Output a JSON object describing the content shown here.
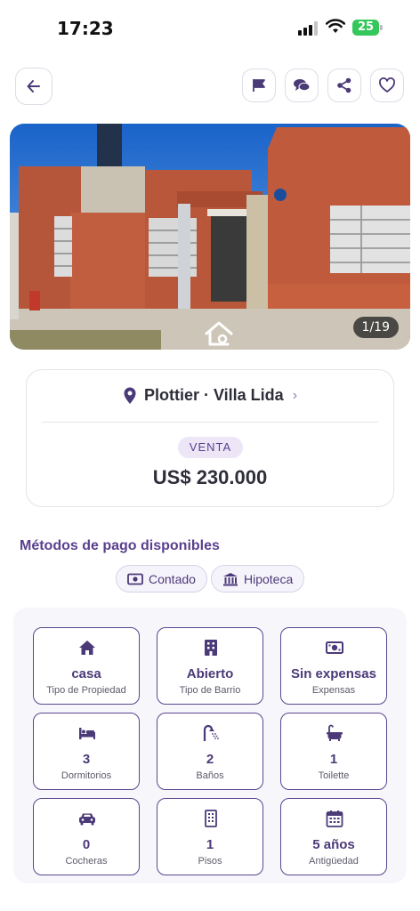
{
  "status_bar": {
    "time": "17:23",
    "battery": "25"
  },
  "header": {
    "back_icon": "arrow-left-icon",
    "actions": [
      "flag-icon",
      "chat-icon",
      "share-icon",
      "heart-icon"
    ]
  },
  "gallery": {
    "counter": "1/19"
  },
  "listing": {
    "location": "Plottier · Villa Lida",
    "operation": "VENTA",
    "price": "US$ 230.000"
  },
  "payment": {
    "title": "Métodos de pago disponibles",
    "methods": [
      {
        "label": "Contado",
        "icon": "cash-icon"
      },
      {
        "label": "Hipoteca",
        "icon": "bank-icon"
      }
    ]
  },
  "features": [
    {
      "value": "casa",
      "label": "Tipo de Propiedad",
      "icon": "house-icon"
    },
    {
      "value": "Abierto",
      "label": "Tipo de Barrio",
      "icon": "building-icon"
    },
    {
      "value": "Sin expensas",
      "label": "Expensas",
      "icon": "money-icon"
    },
    {
      "value": "3",
      "label": "Dormitorios",
      "icon": "bed-icon"
    },
    {
      "value": "2",
      "label": "Baños",
      "icon": "shower-icon"
    },
    {
      "value": "1",
      "label": "Toilette",
      "icon": "bathtub-icon"
    },
    {
      "value": "0",
      "label": "Cocheras",
      "icon": "car-icon"
    },
    {
      "value": "1",
      "label": "Pisos",
      "icon": "floors-icon"
    },
    {
      "value": "5 años",
      "label": "Antigüedad",
      "icon": "calendar-icon"
    }
  ],
  "colors": {
    "accent": "#5a3f8e",
    "battery": "#34c759"
  }
}
